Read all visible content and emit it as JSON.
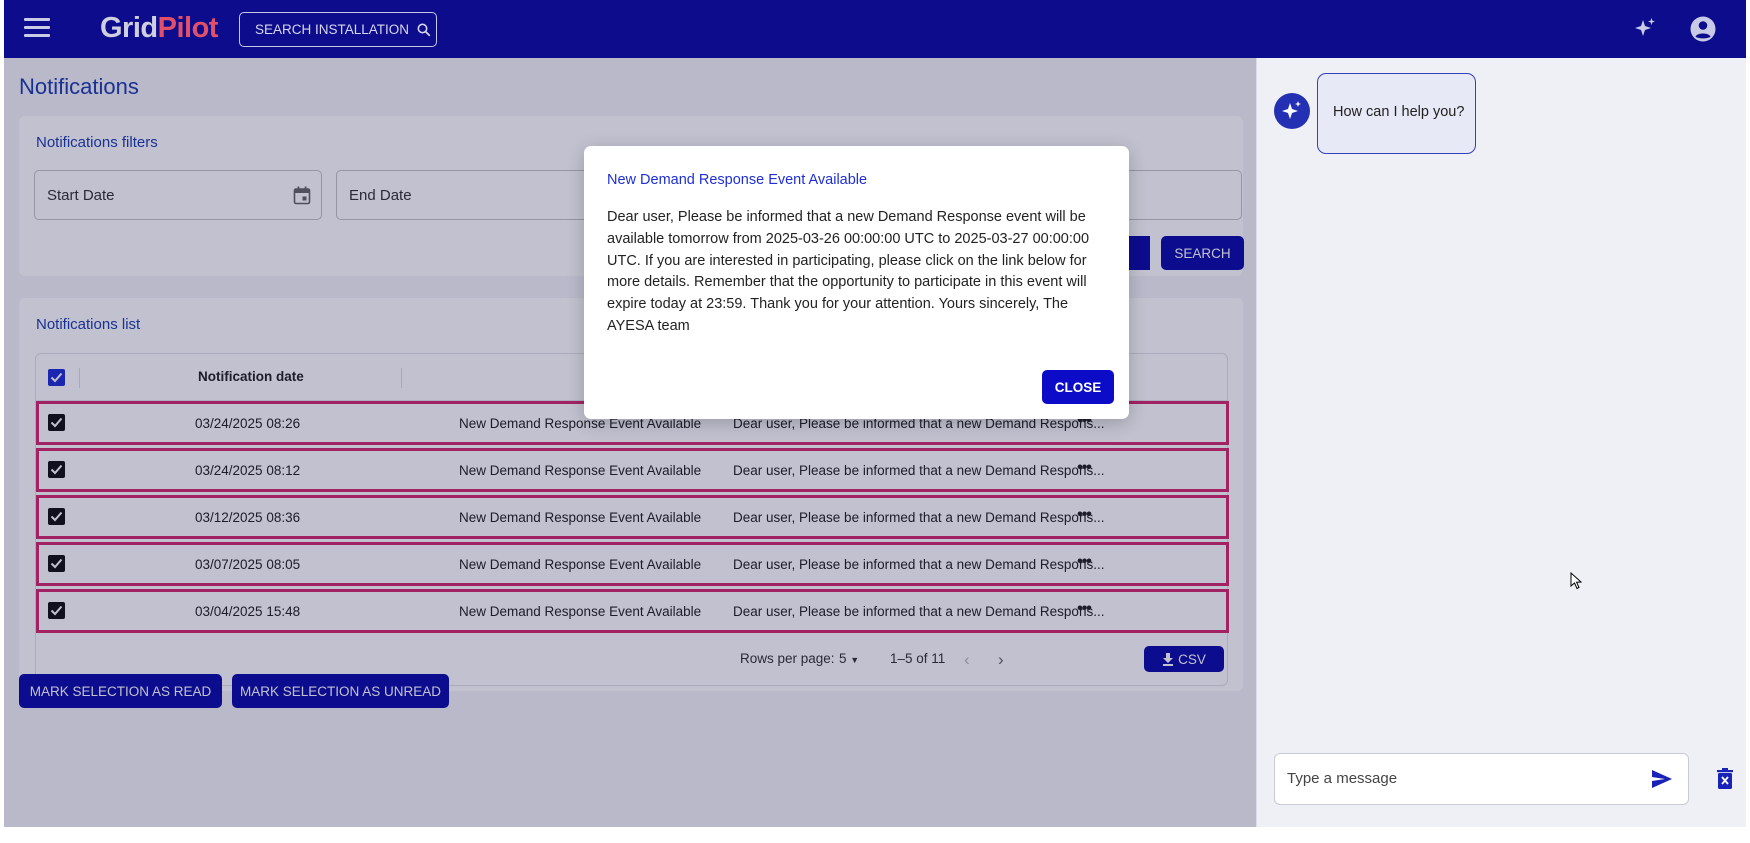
{
  "header": {
    "logo_grid": "Grid",
    "logo_pilot": "Pilot",
    "search_installation": "SEARCH INSTALLATION"
  },
  "page": {
    "title": "Notifications"
  },
  "filters": {
    "title": "Notifications filters",
    "start_date_label": "Start Date",
    "end_date_label": "End Date",
    "search_button": "SEARCH"
  },
  "list": {
    "title": "Notifications list",
    "columns": [
      "Notification date",
      "",
      ""
    ],
    "rows": [
      {
        "date": "03/24/2025 08:26",
        "subject": "New Demand Response Event Available",
        "message": "Dear user, Please be informed that a new Demand Respons..."
      },
      {
        "date": "03/24/2025 08:12",
        "subject": "New Demand Response Event Available",
        "message": "Dear user, Please be informed that a new Demand Respons..."
      },
      {
        "date": "03/12/2025 08:36",
        "subject": "New Demand Response Event Available",
        "message": "Dear user, Please be informed that a new Demand Respons..."
      },
      {
        "date": "03/07/2025 08:05",
        "subject": "New Demand Response Event Available",
        "message": "Dear user, Please be informed that a new Demand Respons..."
      },
      {
        "date": "03/04/2025 15:48",
        "subject": "New Demand Response Event Available",
        "message": "Dear user, Please be informed that a new Demand Respons..."
      }
    ],
    "row_more": "•••",
    "pagination": {
      "rows_per_page_label": "Rows per page:",
      "rows_per_page_value": "5",
      "range": "1–5 of 11"
    },
    "csv_button": "CSV"
  },
  "actions": {
    "mark_read": "MARK SELECTION AS READ",
    "mark_unread": "MARK SELECTION AS UNREAD"
  },
  "assistant": {
    "greeting": "How can I help you?",
    "input_placeholder": "Type a message"
  },
  "modal": {
    "title": "New Demand Response Event Available",
    "body": "Dear user, Please be informed that a new Demand Response event will be available tomorrow from 2025-03-26 00:00:00 UTC to 2025-03-27 00:00:00 UTC. If you are interested in participating, please click on the link below for more details. Remember that the opportunity to participate in this event will expire today at 23:59. Thank you for your attention. Yours sincerely, The AYESA team",
    "close_button": "CLOSE"
  },
  "colors": {
    "header_bg": "#0c0c8c",
    "primary": "#0c0ca8",
    "title_blue": "#1e3db0",
    "row_highlight": "#d42a6e",
    "logo_accent": "#e0506a"
  },
  "icons": [
    "menu-icon",
    "search-icon",
    "sparkle-icon",
    "account-icon",
    "calendar-icon",
    "download-icon",
    "send-icon",
    "delete-icon"
  ]
}
